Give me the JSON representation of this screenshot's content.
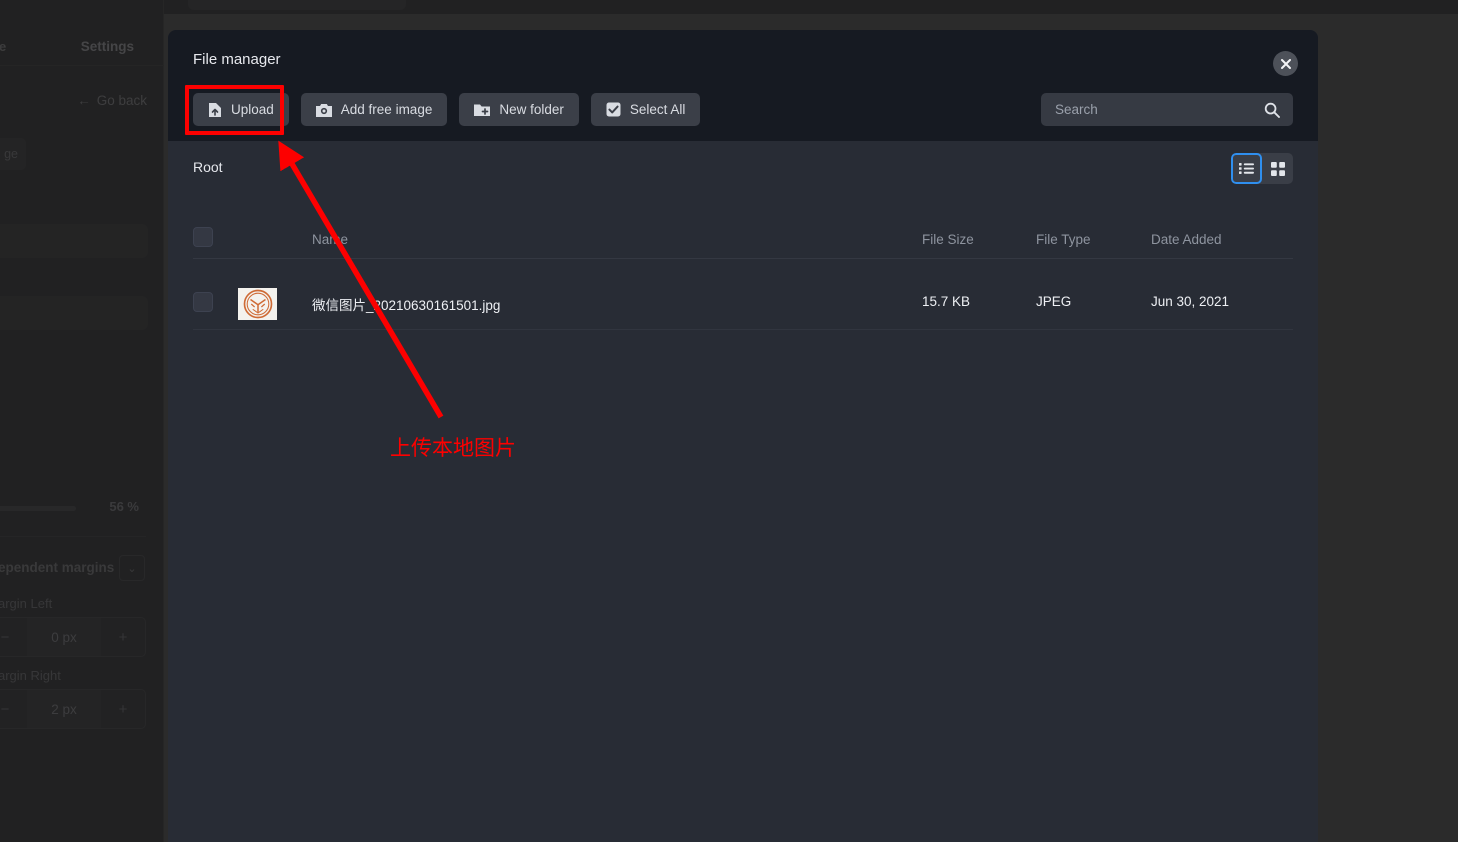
{
  "background_app": {
    "sidebar": {
      "nav_left_label": "re",
      "nav_settings_label": "Settings",
      "go_back_label": "Go back",
      "go_back_icon": "arrow-left-icon",
      "chip_label": "ge",
      "progress_value": "56 %",
      "margins_mode_label": "ependent margins",
      "margins_dropdown_icon": "chevron-down-icon",
      "margin_left_label": "argin Left",
      "margin_left_value": "0 px",
      "margin_right_label": "argin Right",
      "margin_right_value": "2 px",
      "stepper_minus": "−",
      "stepper_plus": "+"
    }
  },
  "modal": {
    "title": "File manager",
    "close_icon": "close-icon",
    "toolbar": [
      {
        "label": "Upload",
        "icon": "file-upload-icon"
      },
      {
        "label": "Add free image",
        "icon": "camera-icon"
      },
      {
        "label": "New folder",
        "icon": "folder-plus-icon"
      },
      {
        "label": "Select All",
        "icon": "checkbox-checked-icon"
      }
    ],
    "search": {
      "placeholder": "Search",
      "value": "",
      "icon": "search-icon"
    },
    "breadcrumb": "Root",
    "view_toggle": {
      "list_icon": "list-view-icon",
      "grid_icon": "grid-view-icon",
      "active": "list",
      "active_color": "#2f8fef"
    },
    "table": {
      "columns": [
        "Name",
        "File Size",
        "File Type",
        "Date Added"
      ],
      "rows": [
        {
          "name": "微信图片_20210630161501.jpg",
          "file_size": "15.7 KB",
          "file_type": "JPEG",
          "date_added": "Jun 30, 2021",
          "thumbnail_icon": "orange-emblem-thumbnail",
          "selected": false
        }
      ]
    }
  },
  "annotations": {
    "highlight_color": "#fd0000",
    "callout_text": "上传本地图片",
    "arrow_icon": "red-arrow-icon",
    "arrow_target": "upload-button"
  }
}
